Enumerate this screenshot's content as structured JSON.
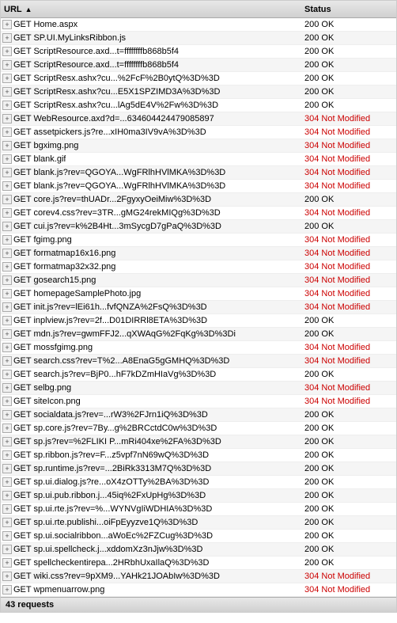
{
  "header": {
    "url_label": "URL",
    "status_label": "Status",
    "sort_arrow": "▲"
  },
  "rows": [
    {
      "url": "GET Home.aspx",
      "status": "200 OK",
      "status_type": "ok"
    },
    {
      "url": "GET SP.UI.MyLinksRibbon.js",
      "status": "200 OK",
      "status_type": "ok"
    },
    {
      "url": "GET ScriptResource.axd...t=ffffffffb868b5f4",
      "status": "200 OK",
      "status_type": "ok"
    },
    {
      "url": "GET ScriptResource.axd...t=ffffffffb868b5f4",
      "status": "200 OK",
      "status_type": "ok"
    },
    {
      "url": "GET ScriptResx.ashx?cu...%2FcF%2B0ytQ%3D%3D",
      "status": "200 OK",
      "status_type": "ok"
    },
    {
      "url": "GET ScriptResx.ashx?cu...E5X1SPZIMD3A%3D%3D",
      "status": "200 OK",
      "status_type": "ok"
    },
    {
      "url": "GET ScriptResx.ashx?cu...lAg5dE4V%2Fw%3D%3D",
      "status": "200 OK",
      "status_type": "ok"
    },
    {
      "url": "GET WebResource.axd?d=...634604424479085897",
      "status": "304 Not Modified",
      "status_type": "304"
    },
    {
      "url": "GET assetpickers.js?re...xIH0ma3IV9vA%3D%3D",
      "status": "304 Not Modified",
      "status_type": "304"
    },
    {
      "url": "GET bgximg.png",
      "status": "304 Not Modified",
      "status_type": "304"
    },
    {
      "url": "GET blank.gif",
      "status": "304 Not Modified",
      "status_type": "304"
    },
    {
      "url": "GET blank.js?rev=QGOYA...WgFRlhHVlMKA%3D%3D",
      "status": "304 Not Modified",
      "status_type": "304"
    },
    {
      "url": "GET blank.js?rev=QGOYA...WgFRlhHVlMKA%3D%3D",
      "status": "304 Not Modified",
      "status_type": "304"
    },
    {
      "url": "GET core.js?rev=thUADr...2FgyxyOeiMiw%3D%3D",
      "status": "200 OK",
      "status_type": "ok"
    },
    {
      "url": "GET corev4.css?rev=3TR...gMG24rekMIQg%3D%3D",
      "status": "304 Not Modified",
      "status_type": "304"
    },
    {
      "url": "GET cui.js?rev=k%2B4Ht...3mSycgD7gPaQ%3D%3D",
      "status": "200 OK",
      "status_type": "ok"
    },
    {
      "url": "GET fgimg.png",
      "status": "304 Not Modified",
      "status_type": "304"
    },
    {
      "url": "GET formatmap16x16.png",
      "status": "304 Not Modified",
      "status_type": "304"
    },
    {
      "url": "GET formatmap32x32.png",
      "status": "304 Not Modified",
      "status_type": "304"
    },
    {
      "url": "GET gosearch15.png",
      "status": "304 Not Modified",
      "status_type": "304"
    },
    {
      "url": "GET homepageSamplePhoto.jpg",
      "status": "304 Not Modified",
      "status_type": "304"
    },
    {
      "url": "GET init.js?rev=lEi61h...fvfQNZA%2FsQ%3D%3D",
      "status": "304 Not Modified",
      "status_type": "304"
    },
    {
      "url": "GET inplview.js?rev=2f...D01DIRRl8ETA%3D%3D",
      "status": "200 OK",
      "status_type": "ok"
    },
    {
      "url": "GET mdn.js?rev=gwmFFJ2...qXWAqG%2FqKg%3D%3Di",
      "status": "200 OK",
      "status_type": "ok"
    },
    {
      "url": "GET mossfgimg.png",
      "status": "304 Not Modified",
      "status_type": "304"
    },
    {
      "url": "GET search.css?rev=T%2...A8EnaG5gGMHQ%3D%3D",
      "status": "304 Not Modified",
      "status_type": "304"
    },
    {
      "url": "GET search.js?rev=BjP0...hF7kDZmHIaVg%3D%3D",
      "status": "200 OK",
      "status_type": "ok"
    },
    {
      "url": "GET selbg.png",
      "status": "304 Not Modified",
      "status_type": "304"
    },
    {
      "url": "GET siteIcon.png",
      "status": "304 Not Modified",
      "status_type": "304"
    },
    {
      "url": "GET socialdata.js?rev=...rW3%2FJrn1iQ%3D%3D",
      "status": "200 OK",
      "status_type": "ok"
    },
    {
      "url": "GET sp.core.js?rev=7By...g%2BRCctdC0w%3D%3D",
      "status": "200 OK",
      "status_type": "ok"
    },
    {
      "url": "GET sp.js?rev=%2FLIKI P...mRi404xe%2FA%3D%3D",
      "status": "200 OK",
      "status_type": "ok"
    },
    {
      "url": "GET sp.ribbon.js?rev=F...z5vpf7nN69wQ%3D%3D",
      "status": "200 OK",
      "status_type": "ok"
    },
    {
      "url": "GET sp.runtime.js?rev=...2BiRk3313M7Q%3D%3D",
      "status": "200 OK",
      "status_type": "ok"
    },
    {
      "url": "GET sp.ui.dialog.js?re...oX4zOTTy%2BA%3D%3D",
      "status": "200 OK",
      "status_type": "ok"
    },
    {
      "url": "GET sp.ui.pub.ribbon.j...45iq%2FxUpHg%3D%3D",
      "status": "200 OK",
      "status_type": "ok"
    },
    {
      "url": "GET sp.ui.rte.js?rev=%...WYNVgIiWDHIA%3D%3D",
      "status": "200 OK",
      "status_type": "ok"
    },
    {
      "url": "GET sp.ui.rte.publishi...oiFpEyyzve1Q%3D%3D",
      "status": "200 OK",
      "status_type": "ok"
    },
    {
      "url": "GET sp.ui.socialribbon...aWoEc%2FZCug%3D%3D",
      "status": "200 OK",
      "status_type": "ok"
    },
    {
      "url": "GET sp.ui.spellcheck.j...xddomXz3nJjw%3D%3D",
      "status": "200 OK",
      "status_type": "ok"
    },
    {
      "url": "GET spellcheckentirepa...2HRbhUxaIlaQ%3D%3D",
      "status": "200 OK",
      "status_type": "ok"
    },
    {
      "url": "GET wiki.css?rev=9pXM9...YAHk21JOAbIw%3D%3D",
      "status": "304 Not Modified",
      "status_type": "304"
    },
    {
      "url": "GET wpmenuarrow.png",
      "status": "304 Not Modified",
      "status_type": "304"
    }
  ],
  "footer": {
    "label": "43 requests"
  }
}
